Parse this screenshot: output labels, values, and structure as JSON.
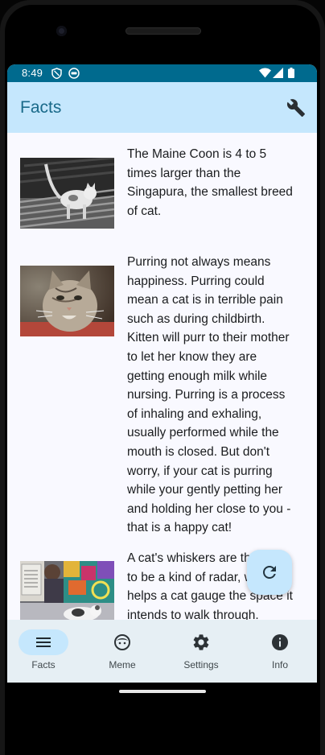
{
  "status_bar": {
    "time": "8:49",
    "icons": [
      "shield-icon",
      "face-icon",
      "wifi-icon",
      "signal-icon",
      "battery-icon"
    ]
  },
  "app_bar": {
    "title": "Facts",
    "action_icon": "wrench-icon"
  },
  "facts": [
    {
      "image": "cat-walking-photo",
      "text": "The Maine Coon is 4 to 5\ntimes larger than the\nSingapura, the smallest breed\nof cat."
    },
    {
      "image": "tabby-cat-photo",
      "text": "Purring not always means\nhappiness. Purring could\nmean a cat is in terrible pain\nsuch as during childbirth.\nKitten will purr to their mother\nto let her know they are\ngetting enough milk while\nnursing. Purring is a process\nof inhaling and exhaling,\nusually performed while the\nmouth is closed. But don't\nworry, if your cat is purring\nwhile your gently petting her\nand holding her close to you -\nthat is a happy cat!"
    },
    {
      "image": "cat-on-couch-photo",
      "text": "A cat's whiskers are thought\nto be a kind of radar, which\nhelps a cat gauge the space it\nintends to walk through."
    }
  ],
  "fab": {
    "icon": "refresh-icon"
  },
  "bottom_nav": [
    {
      "label": "Facts",
      "icon": "menu-icon",
      "active": true
    },
    {
      "label": "Meme",
      "icon": "face-icon",
      "active": false
    },
    {
      "label": "Settings",
      "icon": "gear-icon",
      "active": false
    },
    {
      "label": "Info",
      "icon": "info-icon",
      "active": false
    }
  ],
  "colors": {
    "status_bar": "#006a8e",
    "app_bar": "#c5e7fd",
    "title": "#1a6a8a",
    "background": "#f9f9ff",
    "nav_bar": "#e6eff4",
    "active_pill": "#c5e7fd"
  }
}
